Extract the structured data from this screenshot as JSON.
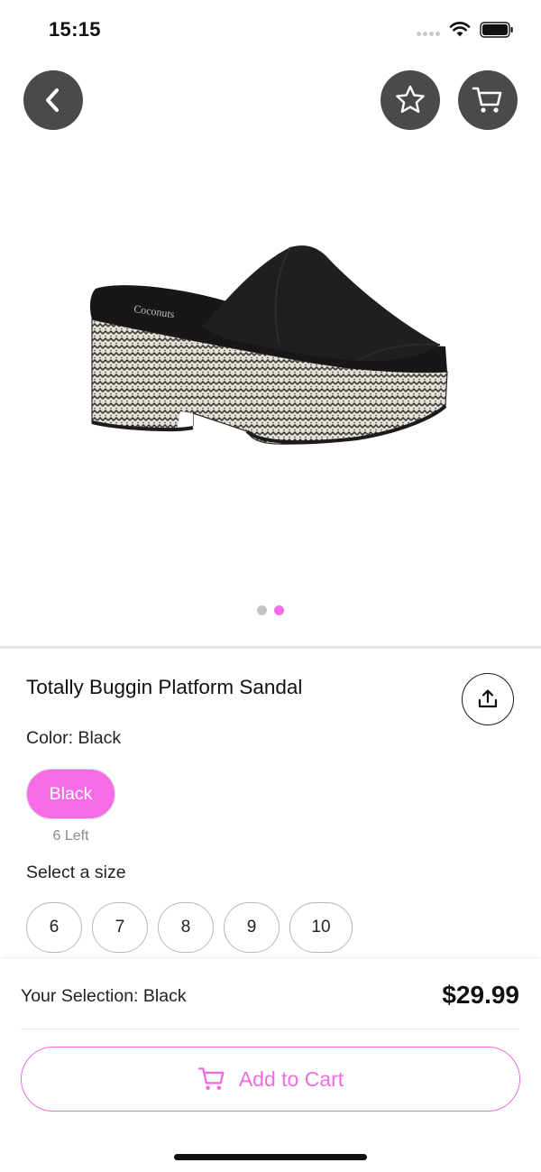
{
  "status_bar": {
    "time": "15:15"
  },
  "product": {
    "title": "Totally Buggin Platform Sandal",
    "image_dots": 2,
    "active_image_index": 1
  },
  "color": {
    "label": "Color:",
    "value": "Black",
    "options": [
      {
        "name": "Black",
        "stock": "6 Left"
      }
    ]
  },
  "size": {
    "label": "Select a size",
    "options": [
      "6",
      "7",
      "8",
      "9",
      "10"
    ]
  },
  "footer": {
    "selection_label": "Your Selection:",
    "selection_value": "Black",
    "price": "$29.99",
    "add_to_cart": "Add to Cart"
  },
  "colors": {
    "accent": "#f76ce6",
    "icon_button_bg": "#4a4a4a",
    "pager_inactive": "#c4c4c4"
  },
  "icons": [
    "chevron-left-icon",
    "star-icon",
    "cart-icon",
    "share-icon",
    "wifi-icon",
    "battery-icon"
  ]
}
